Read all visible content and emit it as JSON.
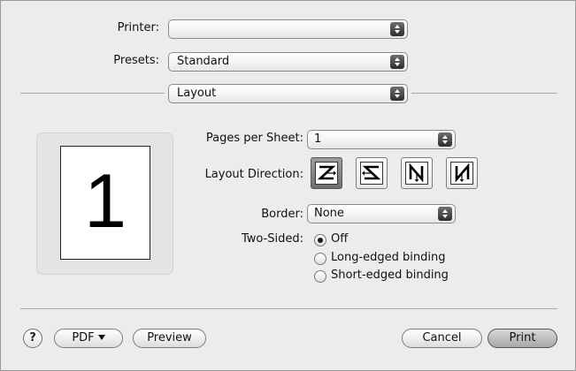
{
  "printer": {
    "label": "Printer:",
    "value": ""
  },
  "presets": {
    "label": "Presets:",
    "value": "Standard"
  },
  "panel": {
    "value": "Layout"
  },
  "preview": {
    "page_number": "1"
  },
  "pages_per_sheet": {
    "label": "Pages per Sheet:",
    "value": "1"
  },
  "layout_direction": {
    "label": "Layout Direction:",
    "options": [
      "z-left-to-right-icon",
      "s-right-to-left-icon",
      "n-top-to-bottom-icon",
      "reverse-n-icon"
    ],
    "selected_index": 0
  },
  "border": {
    "label": "Border:",
    "value": "None"
  },
  "two_sided": {
    "label": "Two-Sided:",
    "options": [
      {
        "label": "Off",
        "checked": true
      },
      {
        "label": "Long-edged binding",
        "checked": false
      },
      {
        "label": "Short-edged binding",
        "checked": false
      }
    ]
  },
  "buttons": {
    "help": "?",
    "pdf": "PDF",
    "preview": "Preview",
    "cancel": "Cancel",
    "print": "Print"
  }
}
